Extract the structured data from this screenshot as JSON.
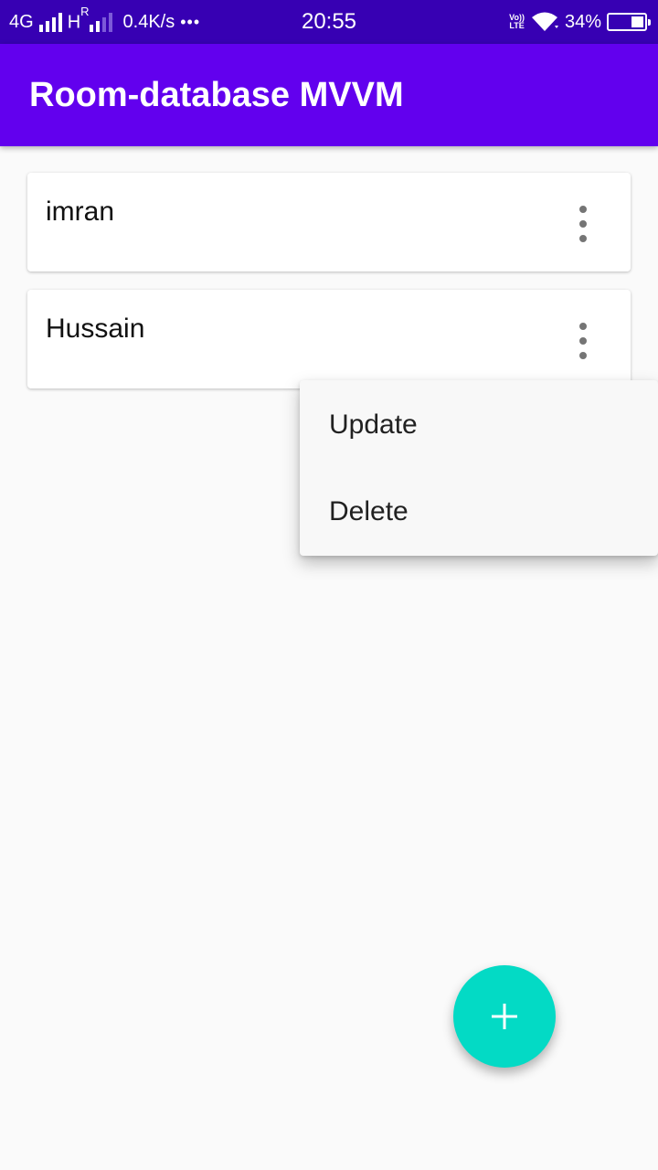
{
  "status_bar": {
    "network": "4G",
    "network2": "H",
    "network2_sup": "R",
    "speed": "0.4K/s",
    "more": "•••",
    "time": "20:55",
    "volte_top": "Vo))",
    "volte_bottom": "LTE",
    "battery": "34%",
    "icons": [
      "signal-icon",
      "wifi-icon",
      "battery-icon"
    ]
  },
  "app_bar": {
    "title": "Room-database MVVM",
    "color": "#6200ee"
  },
  "list": {
    "items": [
      {
        "name": "imran"
      },
      {
        "name": "Hussain"
      }
    ]
  },
  "menu": {
    "items": [
      {
        "label": "Update"
      },
      {
        "label": "Delete"
      }
    ]
  },
  "fab": {
    "icon": "plus-icon",
    "color": "#03dac5"
  }
}
